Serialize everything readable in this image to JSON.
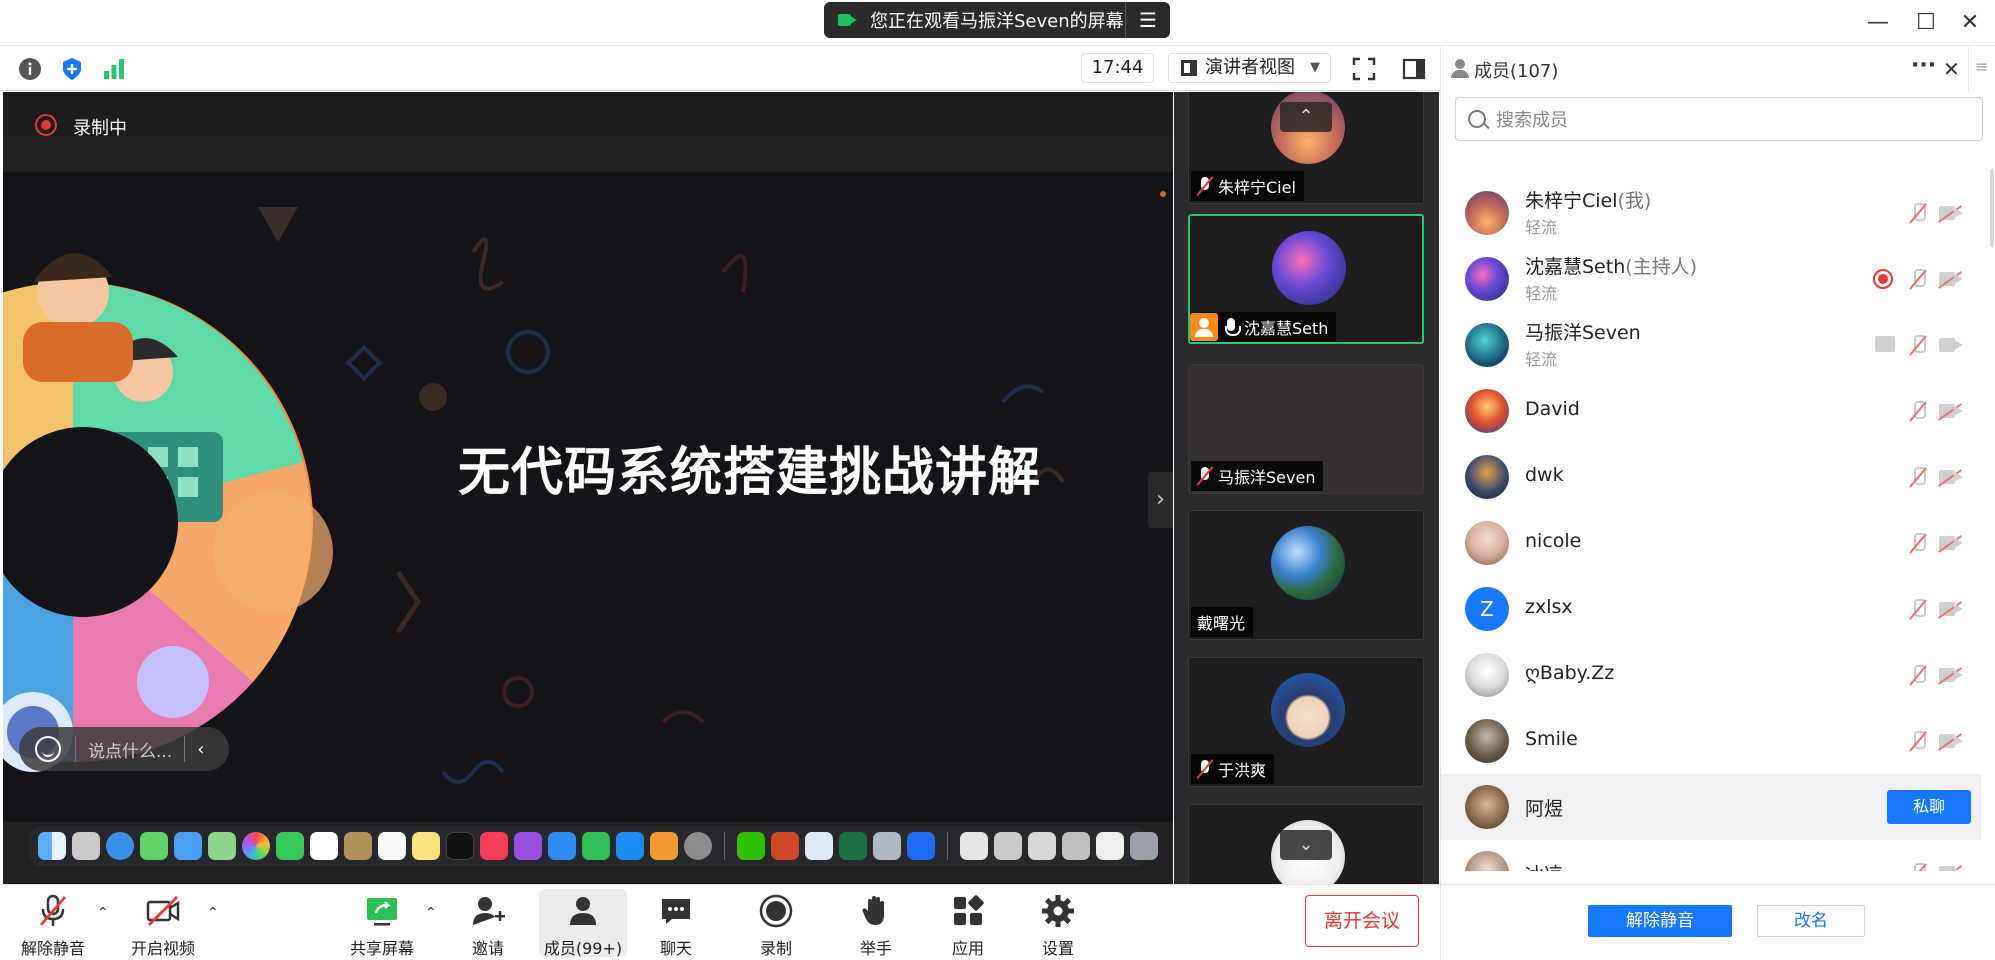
{
  "titlebar": {
    "viewing_text": "您正在观看马振洋Seven的屏幕",
    "minimize_icon": "—",
    "maximize_icon": "☐",
    "close_icon": "✕"
  },
  "toolbar": {
    "clock": "17:44",
    "view_mode": "演讲者视图"
  },
  "stage": {
    "recording_label": "录制中",
    "slide_title": "无代码系统搭建挑战讲解",
    "chat_placeholder": "说点什么..."
  },
  "thumbnails": [
    {
      "name": "朱梓宁Ciel",
      "mic": "off"
    },
    {
      "name": "沈嘉慧Seth",
      "mic": "on",
      "host": true
    },
    {
      "name": "马振洋Seven",
      "mic": "off"
    },
    {
      "name": "戴曙光",
      "mic": "none"
    },
    {
      "name": "于洪爽",
      "mic": "off"
    }
  ],
  "controls": {
    "unmute": "解除静音",
    "start_video": "开启视频",
    "share_screen": "共享屏幕",
    "invite": "邀请",
    "members": "成员(99+)",
    "chat": "聊天",
    "record": "录制",
    "raise_hand": "举手",
    "apps": "应用",
    "settings": "设置",
    "leave": "离开会议"
  },
  "panel": {
    "title": "成员(107)",
    "more_icon": "···",
    "close_icon": "✕",
    "search_placeholder": "搜索成员",
    "members": [
      {
        "name": "朱梓宁Ciel",
        "role": "(我)",
        "sub": "轻流"
      },
      {
        "name": "沈嘉慧Seth",
        "role": "(主持人)",
        "sub": "轻流"
      },
      {
        "name": "马振洋Seven",
        "role": "",
        "sub": "轻流"
      },
      {
        "name": "David",
        "role": "",
        "sub": ""
      },
      {
        "name": "dwk",
        "role": "",
        "sub": ""
      },
      {
        "name": "nicole",
        "role": "",
        "sub": ""
      },
      {
        "name": "zxlsx",
        "role": "",
        "sub": ""
      },
      {
        "name": "ღBaby.Zz",
        "role": "",
        "sub": ""
      },
      {
        "name": "Smile",
        "role": "",
        "sub": ""
      },
      {
        "name": "阿煜",
        "role": "",
        "sub": ""
      },
      {
        "name": "冰凉",
        "role": "",
        "sub": ""
      }
    ],
    "avatar_letter_zxlsx": "Z",
    "private_chat": "私聊",
    "unmute_all": "解除静音",
    "rename": "改名"
  },
  "colors": {
    "accent": "#1677ff",
    "leave": "#e53935",
    "active_border": "#28c76f"
  }
}
